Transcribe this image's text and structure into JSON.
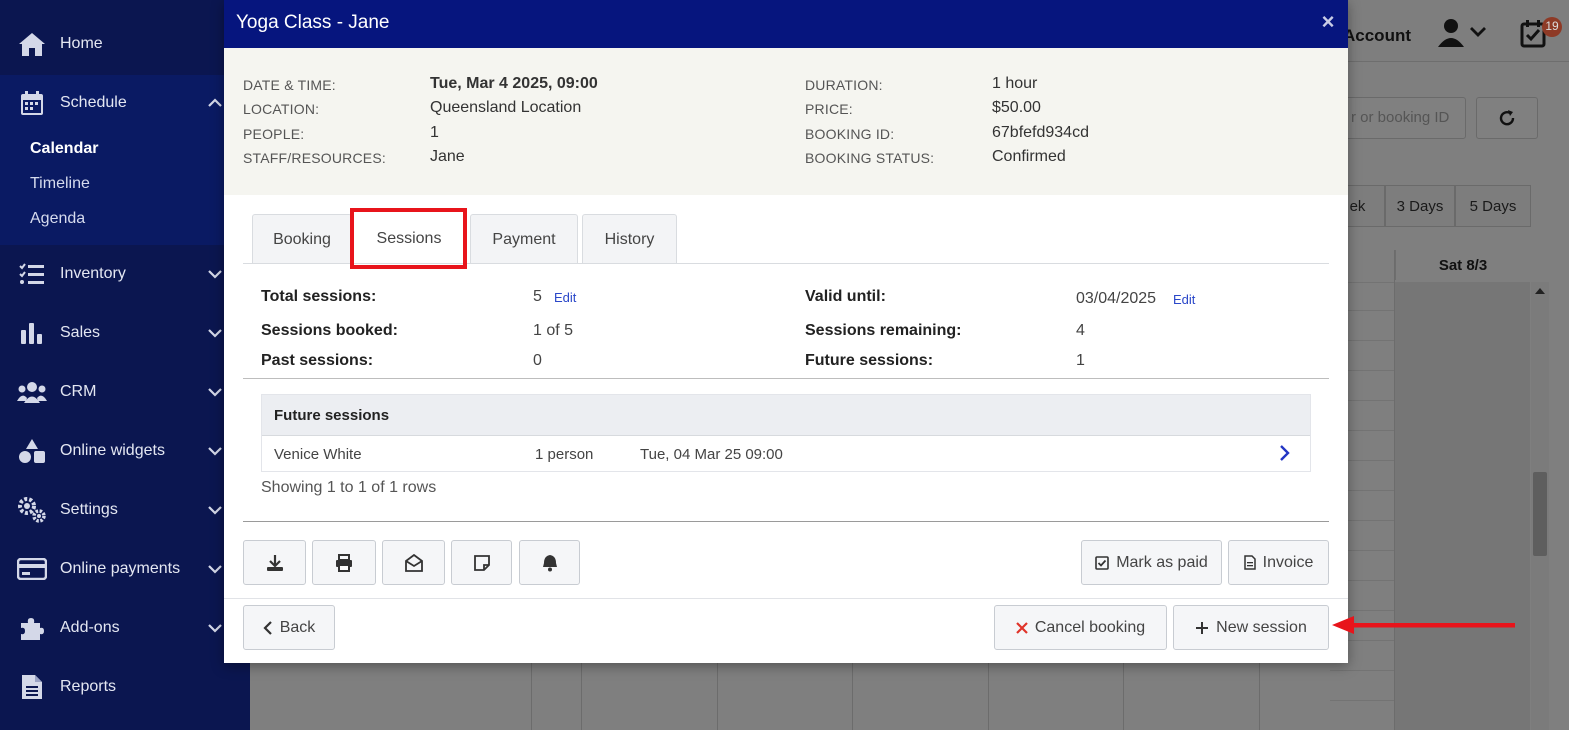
{
  "sidebar": {
    "items": [
      {
        "label": "Home",
        "icon": "home-icon"
      },
      {
        "label": "Schedule",
        "icon": "calendar-icon"
      },
      {
        "label": "Inventory",
        "icon": "list-icon"
      },
      {
        "label": "Sales",
        "icon": "bar-chart-icon"
      },
      {
        "label": "CRM",
        "icon": "users-icon"
      },
      {
        "label": "Online widgets",
        "icon": "shapes-icon"
      },
      {
        "label": "Settings",
        "icon": "gears-icon"
      },
      {
        "label": "Online payments",
        "icon": "credit-card-icon"
      },
      {
        "label": "Add-ons",
        "icon": "puzzle-icon"
      },
      {
        "label": "Reports",
        "icon": "document-icon"
      }
    ],
    "schedule_sub": [
      "Calendar",
      "Timeline",
      "Agenda"
    ],
    "active_sub": "Calendar"
  },
  "background": {
    "account_label": "Account",
    "notification_count": "19",
    "search_placeholder": "r or booking ID",
    "view_buttons": [
      "ek",
      "3 Days",
      "5 Days"
    ],
    "day_header": "Sat 8/3"
  },
  "modal": {
    "title": "Yoga Class - Jane",
    "close": "×",
    "summary": {
      "left": [
        {
          "label": "DATE & TIME:",
          "value": "Tue, Mar 4 2025, 09:00"
        },
        {
          "label": "LOCATION:",
          "value": "Queensland Location"
        },
        {
          "label": "PEOPLE:",
          "value": "1"
        },
        {
          "label": "STAFF/RESOURCES:",
          "value": "Jane"
        }
      ],
      "right": [
        {
          "label": "DURATION:",
          "value": "1 hour"
        },
        {
          "label": "PRICE:",
          "value": "$50.00"
        },
        {
          "label": "BOOKING ID:",
          "value": "67bfefd934cd"
        },
        {
          "label": "BOOKING STATUS:",
          "value": "Confirmed"
        }
      ]
    },
    "tabs": [
      "Booking",
      "Sessions",
      "Payment",
      "History"
    ],
    "active_tab": "Sessions",
    "sessions": {
      "total_label": "Total sessions:",
      "total_value": "5",
      "edit": "Edit",
      "booked_label": "Sessions booked:",
      "booked_value": "1 of 5",
      "past_label": "Past sessions:",
      "past_value": "0",
      "valid_label": "Valid until:",
      "valid_value": "03/04/2025",
      "remaining_label": "Sessions remaining:",
      "remaining_value": "4",
      "future_label": "Future sessions:",
      "future_value": "1"
    },
    "future_table": {
      "heading": "Future sessions",
      "rows": [
        {
          "name": "Venice White",
          "people": "1 person",
          "datetime": "Tue, 04 Mar 25 09:00"
        }
      ],
      "showing": "Showing 1 to 1 of 1 rows"
    },
    "actions": {
      "icon_buttons": [
        "download-icon",
        "print-icon",
        "envelope-open-icon",
        "note-icon",
        "bell-icon"
      ],
      "mark_paid": "Mark as paid",
      "invoice": "Invoice",
      "back": "Back",
      "cancel_booking": "Cancel booking",
      "new_session": "New session"
    }
  },
  "colors": {
    "sidebar_bg": "#0b1650",
    "modal_header": "#06157e",
    "highlight": "#e8141b",
    "link": "#2a47c9",
    "cancel_x": "#e0342a"
  }
}
